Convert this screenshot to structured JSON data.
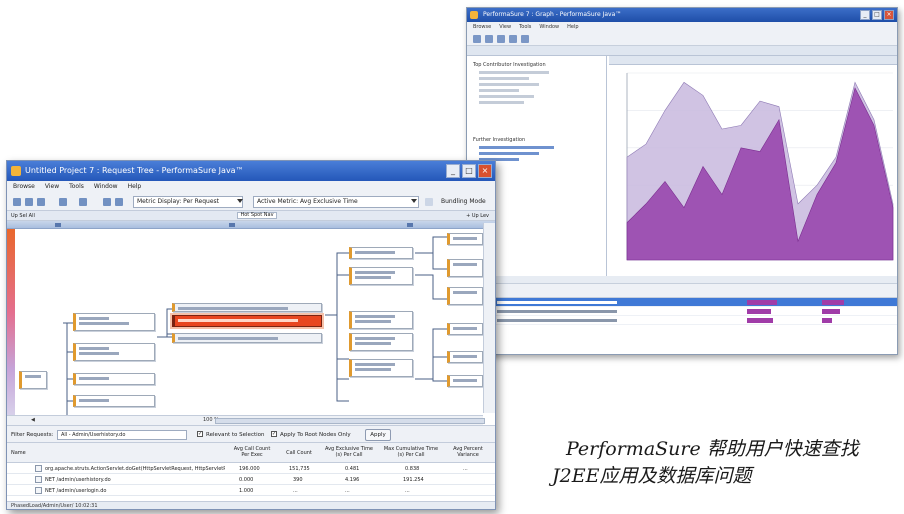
{
  "caption": {
    "line1": "PerformaSure 帮助用户快速查找",
    "line2": "J2EE应用及数据库问题"
  },
  "front_window": {
    "title": "Untitled Project 7 : Request Tree - PerformaSure Java™",
    "menu": [
      "Browse",
      "View",
      "Tools",
      "Window",
      "Help"
    ],
    "toolbar": {
      "metric_display_label": "Metric Display: Per Request",
      "active_metric_label": "Active Metric: Avg Exclusive Time",
      "bundling_label": "Bundling Mode"
    },
    "subbar": {
      "left": "Up Sel All",
      "center": "Hot Spot Nav",
      "right": "+ Up Lev"
    },
    "horizontal_scroll": {
      "left": "◀",
      "zoom": "100 %"
    },
    "filter": {
      "label": "Filter Requests:",
      "value": "All - Admin/Userhistory.do",
      "options": [
        "Relevant to Selection",
        "Apply To Root Nodes Only"
      ],
      "apply_button": "Apply"
    },
    "table": {
      "columns": [
        "Name",
        "Avg Call Count Per Exec",
        "Call Count",
        "Avg Exclusive Time (s) Per Call",
        "Max Cumulative Time (s) Per Call",
        "Avg Percent Variance"
      ],
      "rows": [
        [
          "org.apache.struts.ActionServlet.doGet(HttpServletRequest, HttpServletResponse)",
          "196.000",
          "151,735",
          "0.481",
          "0.838",
          "..."
        ],
        [
          "NET /admin/userhistory.do",
          "0.000",
          "390",
          "4.196",
          "191.254",
          ""
        ],
        [
          "NET /admin/userlogin.do",
          "1.000",
          "...",
          "...",
          "...",
          ""
        ]
      ]
    },
    "status": "PhasedLoad/Admin/User/ 10:02:31"
  },
  "back_window": {
    "title": "PerformaSure 7 : Graph - PerformaSure Java™",
    "menu": [
      "Browse",
      "View",
      "Tools",
      "Window",
      "Help"
    ],
    "left_panel_sections": [
      "Top Contributor Investigation",
      "Further Investigation"
    ],
    "colors": {
      "series_fg": "#9b4db0",
      "series_bg": "#c8b8de"
    }
  },
  "chart_data": {
    "type": "area",
    "title": "",
    "xlabel": "",
    "ylabel": "",
    "x": [
      0,
      1,
      2,
      3,
      4,
      5,
      6,
      7,
      8,
      9,
      10,
      11,
      12,
      13,
      14
    ],
    "series": [
      {
        "values": [
          55,
          62,
          80,
          95,
          88,
          70,
          72,
          85,
          82,
          30,
          40,
          55,
          95,
          75,
          30
        ]
      },
      {
        "values": [
          20,
          30,
          42,
          28,
          50,
          35,
          60,
          58,
          75,
          10,
          35,
          52,
          92,
          72,
          28
        ]
      }
    ],
    "ylim": [
      0,
      100
    ]
  }
}
